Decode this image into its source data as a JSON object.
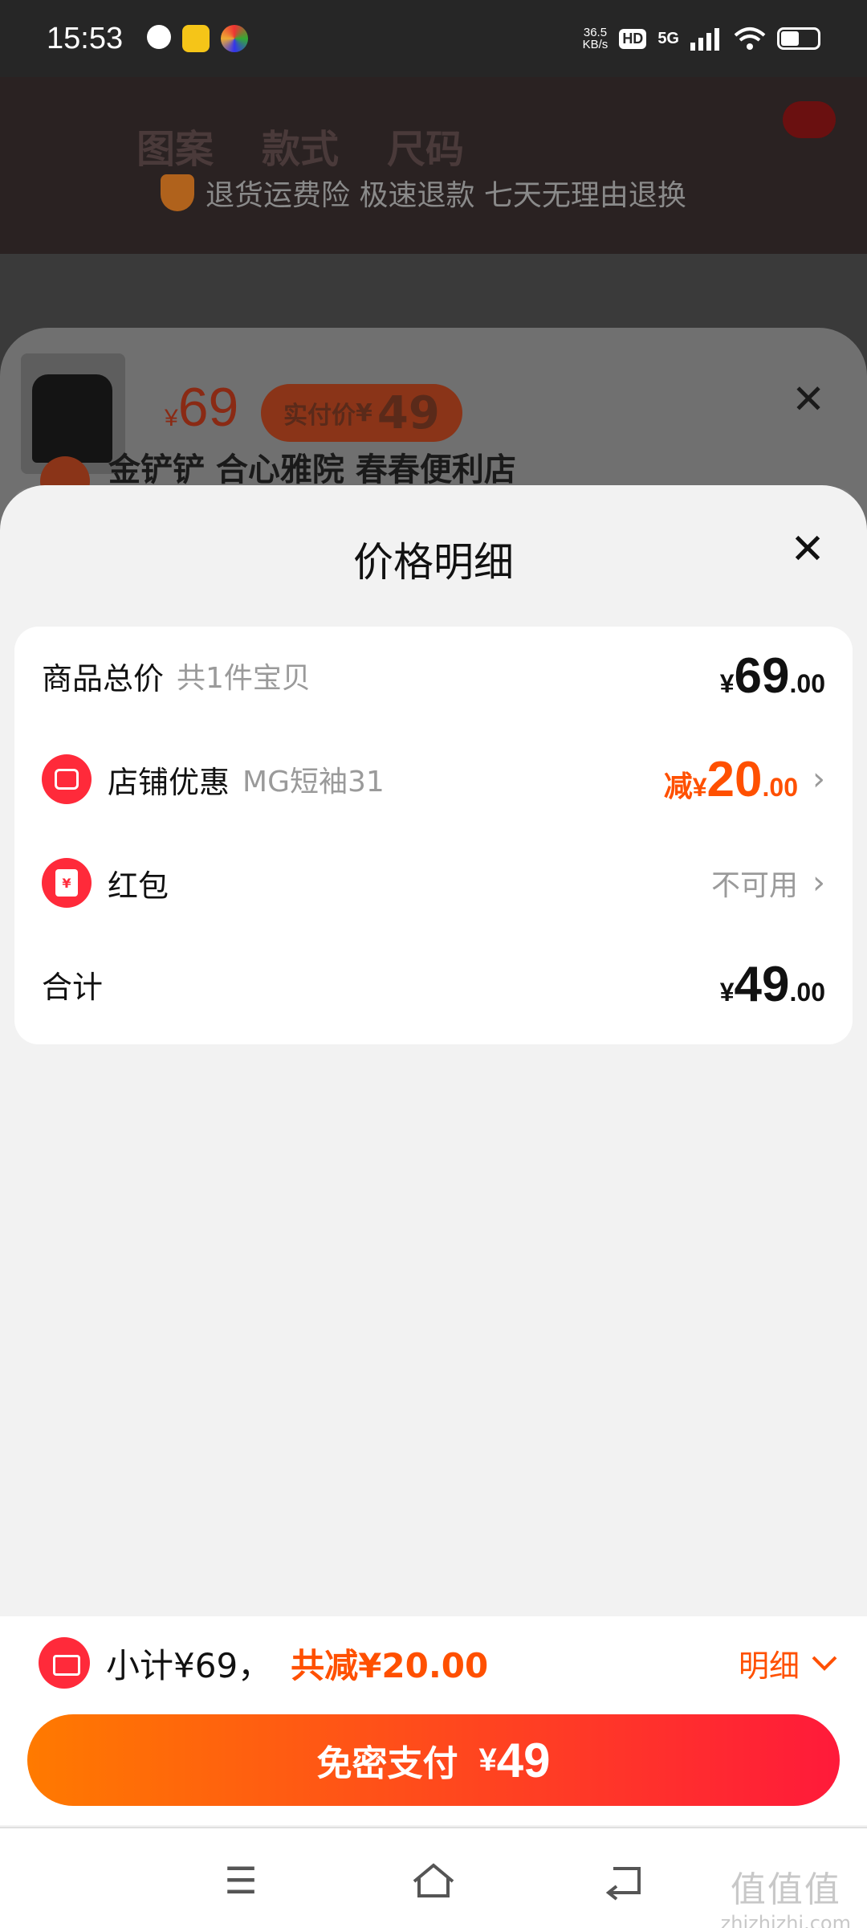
{
  "status_bar": {
    "time": "15:53",
    "net_speed_value": "36.5",
    "net_speed_unit": "KB/s",
    "hd": "HD",
    "network": "5G"
  },
  "background": {
    "tabs": [
      "图案",
      "款式",
      "尺码"
    ],
    "guarantee": "退货运费险 极速退款 七天无理由退换",
    "product_price_symbol": "¥",
    "product_price": "69",
    "paid_label": "实付价",
    "paid_symbol": "¥",
    "paid_amount": "49",
    "store_text": "金铲铲 合心雅院 春春便利店",
    "close_icon": "close-icon"
  },
  "price_detail": {
    "title": "价格明细",
    "close_icon": "close-icon",
    "rows": {
      "total": {
        "label": "商品总价",
        "sub": "共1件宝贝",
        "yen": "¥",
        "int": "69",
        "dec": ".00"
      },
      "store_discount": {
        "icon": "store-icon",
        "label": "店铺优惠",
        "sub": "MG短袖31",
        "prefix": "减",
        "yen": "¥",
        "int": "20",
        "dec": ".00"
      },
      "red_packet": {
        "icon": "red-packet-icon",
        "label": "红包",
        "status": "不可用"
      },
      "sum": {
        "label": "合计",
        "yen": "¥",
        "int": "49",
        "dec": ".00"
      }
    }
  },
  "bottom": {
    "subtotal": "小计¥69，",
    "discount": "共减¥20.00",
    "detail_label": "明细",
    "pay_label": "免密支付",
    "pay_yen": "¥",
    "pay_amount": "49"
  },
  "watermark": {
    "big": "值值值",
    "small": "zhizhizhi.com"
  },
  "colors": {
    "accent": "#ff5000",
    "button_gradient_start": "#ff7a00",
    "button_gradient_end": "#ff1a3a",
    "icon_red": "#ff2a3a"
  }
}
